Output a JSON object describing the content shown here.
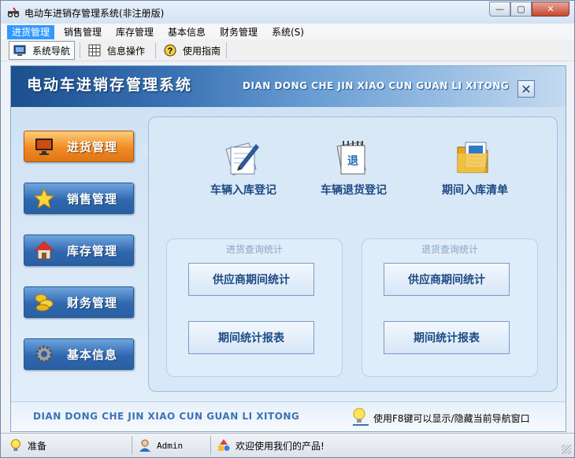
{
  "window": {
    "title": "电动车进销存管理系统(非注册版)",
    "controls": {
      "minimize": "—",
      "maximize": "▢",
      "close": "✕"
    }
  },
  "menubar": {
    "items": [
      {
        "label": "进货管理",
        "active": true
      },
      {
        "label": "销售管理",
        "active": false
      },
      {
        "label": "库存管理",
        "active": false
      },
      {
        "label": "基本信息",
        "active": false
      },
      {
        "label": "财务管理",
        "active": false
      },
      {
        "label": "系统(S)",
        "active": false
      }
    ]
  },
  "toolbar": {
    "items": [
      {
        "label": "系统导航",
        "icon": "monitor-icon",
        "pressed": true
      },
      {
        "label": "信息操作",
        "icon": "grid-icon",
        "pressed": false
      },
      {
        "label": "使用指南",
        "icon": "help-icon",
        "pressed": false
      }
    ]
  },
  "banner": {
    "title": "电动车进销存管理系统",
    "subtitle": "DIAN DONG CHE JIN XIAO CUN GUAN LI XITONG",
    "close": "✕"
  },
  "sidebar": {
    "items": [
      {
        "label": "进货管理",
        "icon": "monitor-icon",
        "active": true
      },
      {
        "label": "销售管理",
        "icon": "star-icon",
        "active": false
      },
      {
        "label": "库存管理",
        "icon": "house-icon",
        "active": false
      },
      {
        "label": "财务管理",
        "icon": "coins-icon",
        "active": false
      },
      {
        "label": "基本信息",
        "icon": "gear-icon",
        "active": false
      }
    ]
  },
  "main": {
    "actions": [
      {
        "label": "车辆入库登记",
        "icon": "notepad-pen-icon"
      },
      {
        "label": "车辆退货登记",
        "icon": "calendar-return-icon"
      },
      {
        "label": "期间入库清单",
        "icon": "folder-list-icon"
      }
    ],
    "groups": [
      {
        "title": "进货查询统计",
        "buttons": [
          "供应商期间统计",
          "期间统计报表"
        ]
      },
      {
        "title": "退货查询统计",
        "buttons": [
          "供应商期间统计",
          "期间统计报表"
        ]
      }
    ]
  },
  "footer": {
    "subtitle": "DIAN DONG CHE JIN XIAO CUN GUAN LI XITONG",
    "hint": "使用F8键可以显示/隐藏当前导航窗口"
  },
  "statusbar": {
    "status": "准备",
    "user": "Admin",
    "message": "欢迎使用我们的产品!"
  },
  "colors": {
    "accent": "#3399ff",
    "active_sidebar": "#f08a24",
    "sidebar": "#2f68b0",
    "label_text": "#1d4a82"
  }
}
